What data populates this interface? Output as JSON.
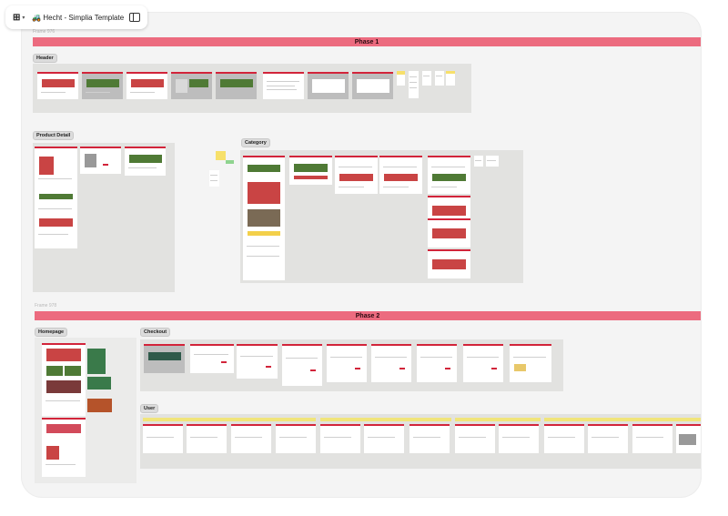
{
  "toolbar": {
    "menu_glyph": "⊞",
    "menu_chevron": "▾",
    "file_emoji": "🚜",
    "file_title": "Hecht - Simplia Template"
  },
  "canvas": {
    "frames": [
      {
        "label": "Frame 976",
        "phase": "Phase 1"
      },
      {
        "label": "Frame 978",
        "phase": "Phase 2"
      }
    ],
    "sections": {
      "header": "Header",
      "product_detail": "Product Detail",
      "category": "Category",
      "homepage": "Homepage",
      "checkout": "Checkout",
      "user": "User"
    }
  },
  "colors": {
    "phase_bar": "#ec6b7f",
    "brand_red": "#d2243a",
    "section_bg": "#e2e2e0",
    "canvas_bg": "#f4f4f4"
  }
}
